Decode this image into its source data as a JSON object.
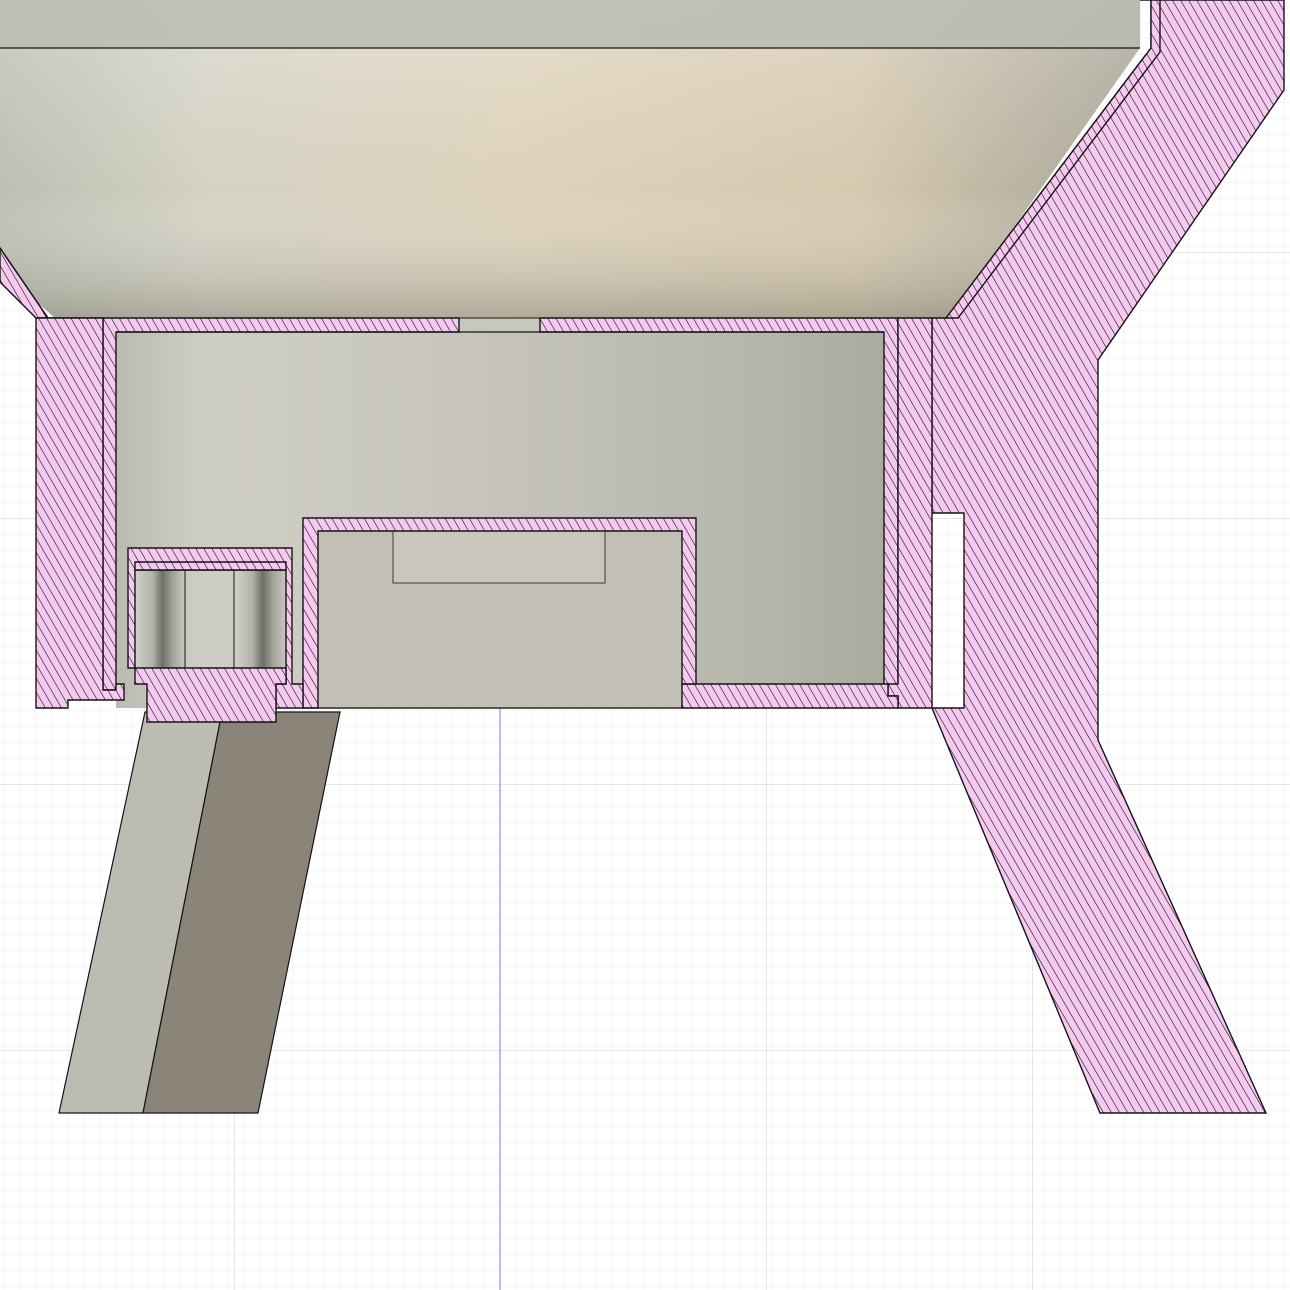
{
  "canvas": {
    "background": "#ffffff",
    "grid_minor_color": "#eeeeee",
    "grid_major_color": "#d6d6d6",
    "axis_color": "#a9a3f5"
  },
  "section": {
    "hatch_color": "#000000",
    "hatch_fill": "#f6c9f0",
    "outline_color": "#141414"
  },
  "bodies": {
    "bowl_interior_color": "#d9cdb4",
    "cavity_color": "#c3c1b7",
    "cylinder_color": "#bdbcb4",
    "block_color": "#c2c0b6",
    "leg_light_color": "#bdbcb2",
    "leg_dark_color": "#8a8479"
  }
}
